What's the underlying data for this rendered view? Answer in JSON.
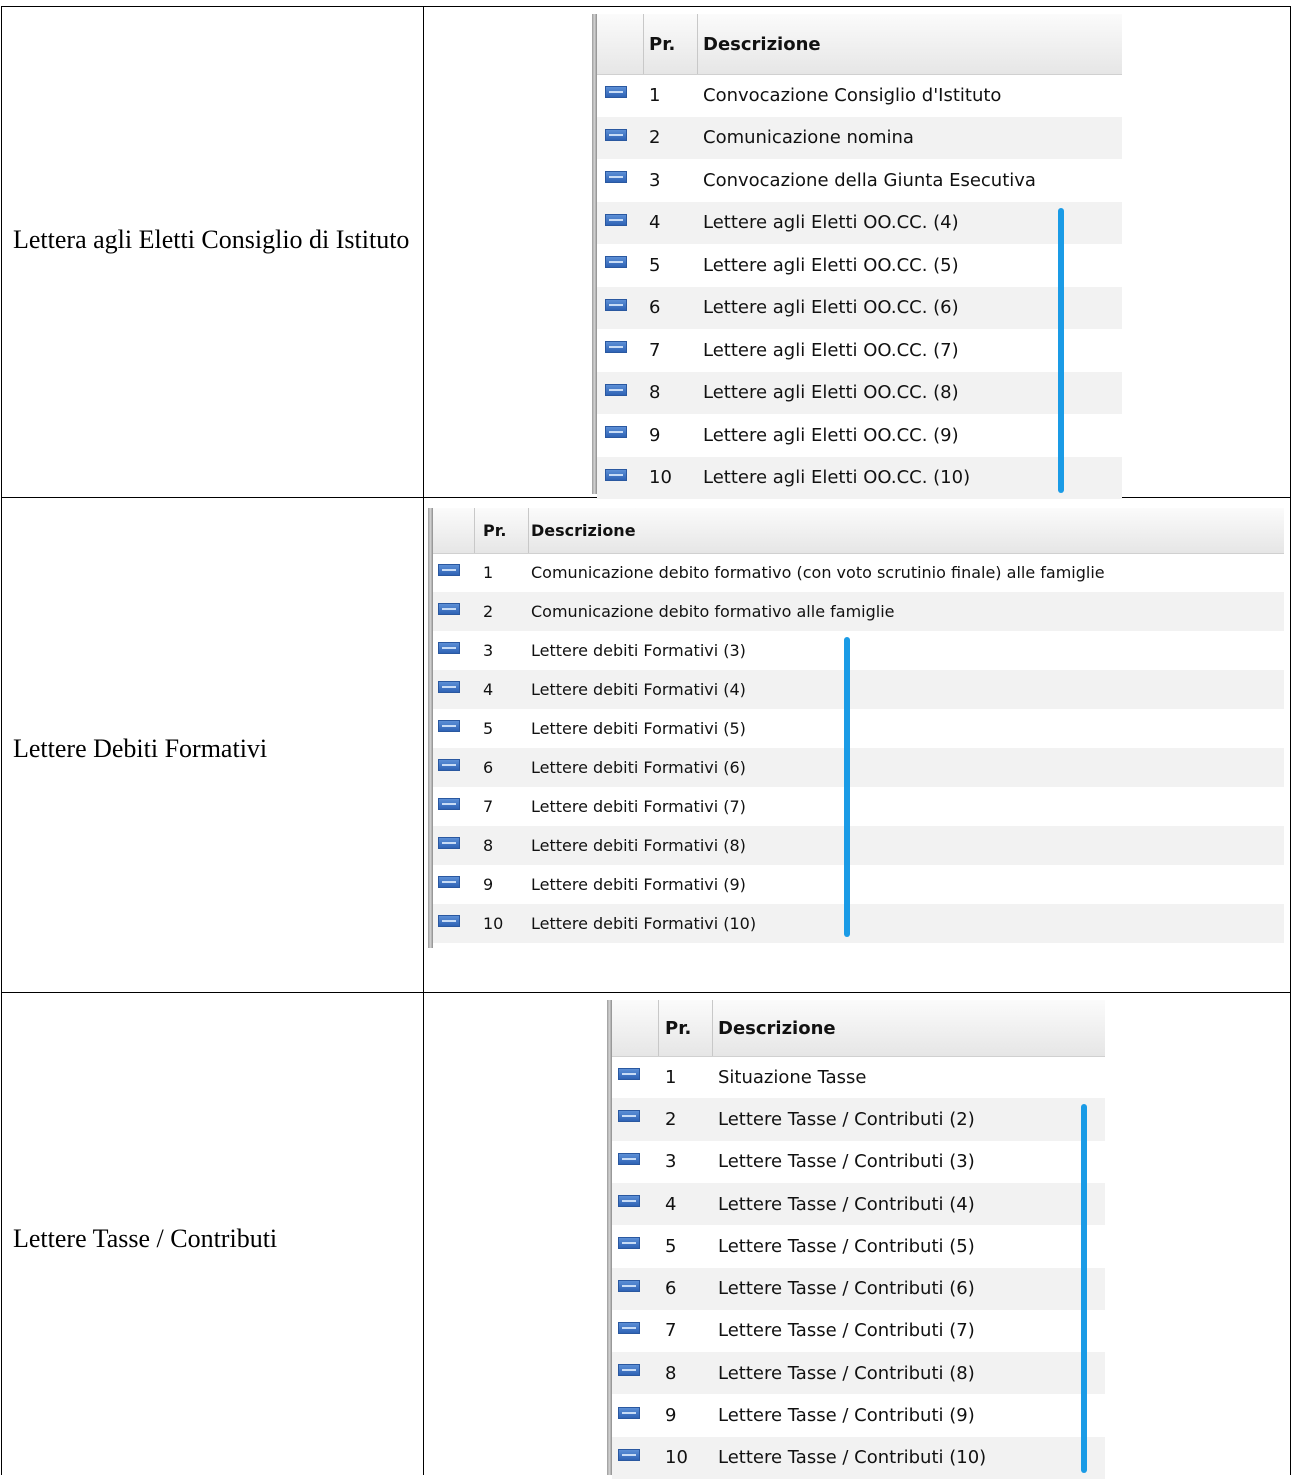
{
  "sections": [
    {
      "label": "Lettera agli Eletti Consiglio di Istituto",
      "header": {
        "pr": "Pr.",
        "descrizione": "Descrizione"
      },
      "icon": "html-file-icon",
      "rows": [
        {
          "pr": "1",
          "desc": "Convocazione Consiglio d'Istituto"
        },
        {
          "pr": "2",
          "desc": "Comunicazione nomina"
        },
        {
          "pr": "3",
          "desc": "Convocazione della Giunta Esecutiva"
        },
        {
          "pr": "4",
          "desc": "Lettere agli Eletti OO.CC. (4)"
        },
        {
          "pr": "5",
          "desc": "Lettere agli Eletti OO.CC. (5)"
        },
        {
          "pr": "6",
          "desc": "Lettere agli Eletti OO.CC. (6)"
        },
        {
          "pr": "7",
          "desc": "Lettere agli Eletti OO.CC. (7)"
        },
        {
          "pr": "8",
          "desc": "Lettere agli Eletti OO.CC. (8)"
        },
        {
          "pr": "9",
          "desc": "Lettere agli Eletti OO.CC. (9)"
        },
        {
          "pr": "10",
          "desc": "Lettere agli Eletti OO.CC. (10)"
        }
      ]
    },
    {
      "label": "Lettere Debiti Formativi",
      "header": {
        "pr": "Pr.",
        "descrizione": "Descrizione"
      },
      "icon": "html-file-icon",
      "rows": [
        {
          "pr": "1",
          "desc": "Comunicazione debito formativo (con voto scrutinio finale) alle famiglie"
        },
        {
          "pr": "2",
          "desc": "Comunicazione debito formativo alle famiglie"
        },
        {
          "pr": "3",
          "desc": "Lettere debiti Formativi (3)"
        },
        {
          "pr": "4",
          "desc": "Lettere debiti Formativi (4)"
        },
        {
          "pr": "5",
          "desc": "Lettere debiti Formativi (5)"
        },
        {
          "pr": "6",
          "desc": "Lettere debiti Formativi (6)"
        },
        {
          "pr": "7",
          "desc": "Lettere debiti Formativi (7)"
        },
        {
          "pr": "8",
          "desc": "Lettere debiti Formativi (8)"
        },
        {
          "pr": "9",
          "desc": "Lettere debiti Formativi (9)"
        },
        {
          "pr": "10",
          "desc": "Lettere debiti Formativi (10)"
        }
      ]
    },
    {
      "label": "Lettere Tasse / Contributi",
      "header": {
        "pr": "Pr.",
        "descrizione": "Descrizione"
      },
      "icon": "html-file-icon",
      "rows": [
        {
          "pr": "1",
          "desc": "Situazione Tasse"
        },
        {
          "pr": "2",
          "desc": "Lettere Tasse / Contributi (2)"
        },
        {
          "pr": "3",
          "desc": "Lettere Tasse / Contributi (3)"
        },
        {
          "pr": "4",
          "desc": "Lettere Tasse / Contributi (4)"
        },
        {
          "pr": "5",
          "desc": "Lettere Tasse / Contributi (5)"
        },
        {
          "pr": "6",
          "desc": "Lettere Tasse / Contributi (6)"
        },
        {
          "pr": "7",
          "desc": "Lettere Tasse / Contributi (7)"
        },
        {
          "pr": "8",
          "desc": "Lettere Tasse / Contributi (8)"
        },
        {
          "pr": "9",
          "desc": "Lettere Tasse / Contributi (9)"
        },
        {
          "pr": "10",
          "desc": "Lettere Tasse / Contributi (10)"
        }
      ]
    }
  ],
  "colors": {
    "bracket": "#1a9be6",
    "alt_row": "#f2f2f2"
  }
}
